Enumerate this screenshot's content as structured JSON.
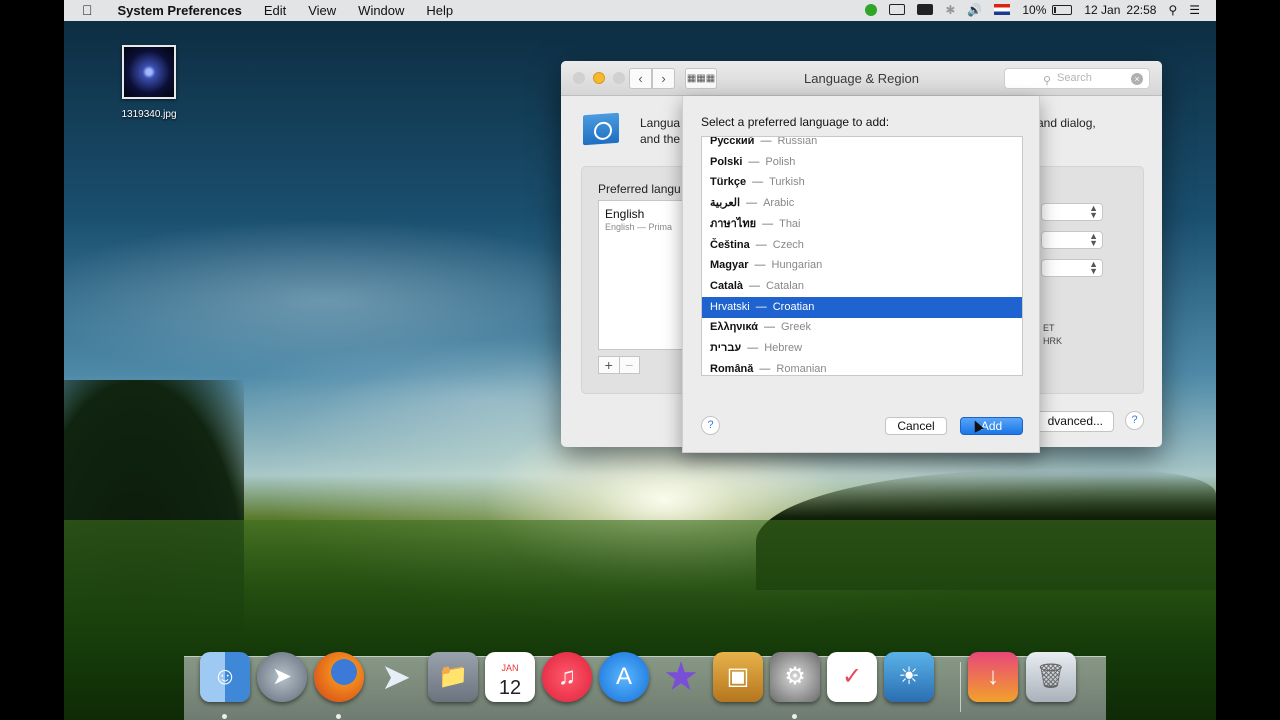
{
  "menubar": {
    "apple": "",
    "app_name": "System Preferences",
    "items": [
      "Edit",
      "View",
      "Window",
      "Help"
    ],
    "status": {
      "battery": "10%",
      "date": "12 Jan",
      "time": "22:58"
    }
  },
  "desktop": {
    "file_name": "1319340.jpg"
  },
  "window": {
    "title": "Language & Region",
    "search_placeholder": "Search",
    "desc_line1": "Langua",
    "desc_line2": "and the",
    "desc_right": "and dialog,",
    "preferred_label": "Preferred langu",
    "languages": {
      "primary": "English",
      "sub": "English — Prima"
    },
    "right_small_1": "ET",
    "right_small_2": "HRK",
    "advanced_button": "dvanced...",
    "help": "?"
  },
  "sheet": {
    "title": "Select a preferred language to add:",
    "rows": [
      {
        "native": "Русский",
        "english": "Russian"
      },
      {
        "native": "Polski",
        "english": "Polish"
      },
      {
        "native": "Türkçe",
        "english": "Turkish"
      },
      {
        "native": "العربية",
        "english": "Arabic"
      },
      {
        "native": "ภาษาไทย",
        "english": "Thai"
      },
      {
        "native": "Čeština",
        "english": "Czech"
      },
      {
        "native": "Magyar",
        "english": "Hungarian"
      },
      {
        "native": "Català",
        "english": "Catalan"
      },
      {
        "native": "Hrvatski",
        "english": "Croatian"
      },
      {
        "native": "Ελληνικά",
        "english": "Greek"
      },
      {
        "native": "עברית",
        "english": "Hebrew"
      },
      {
        "native": "Română",
        "english": "Romanian"
      }
    ],
    "selected_index": 8,
    "help": "?",
    "cancel_button": "Cancel",
    "add_button": "Add"
  },
  "dock": {
    "calendar_day": "12",
    "calendar_month": "JAN"
  }
}
